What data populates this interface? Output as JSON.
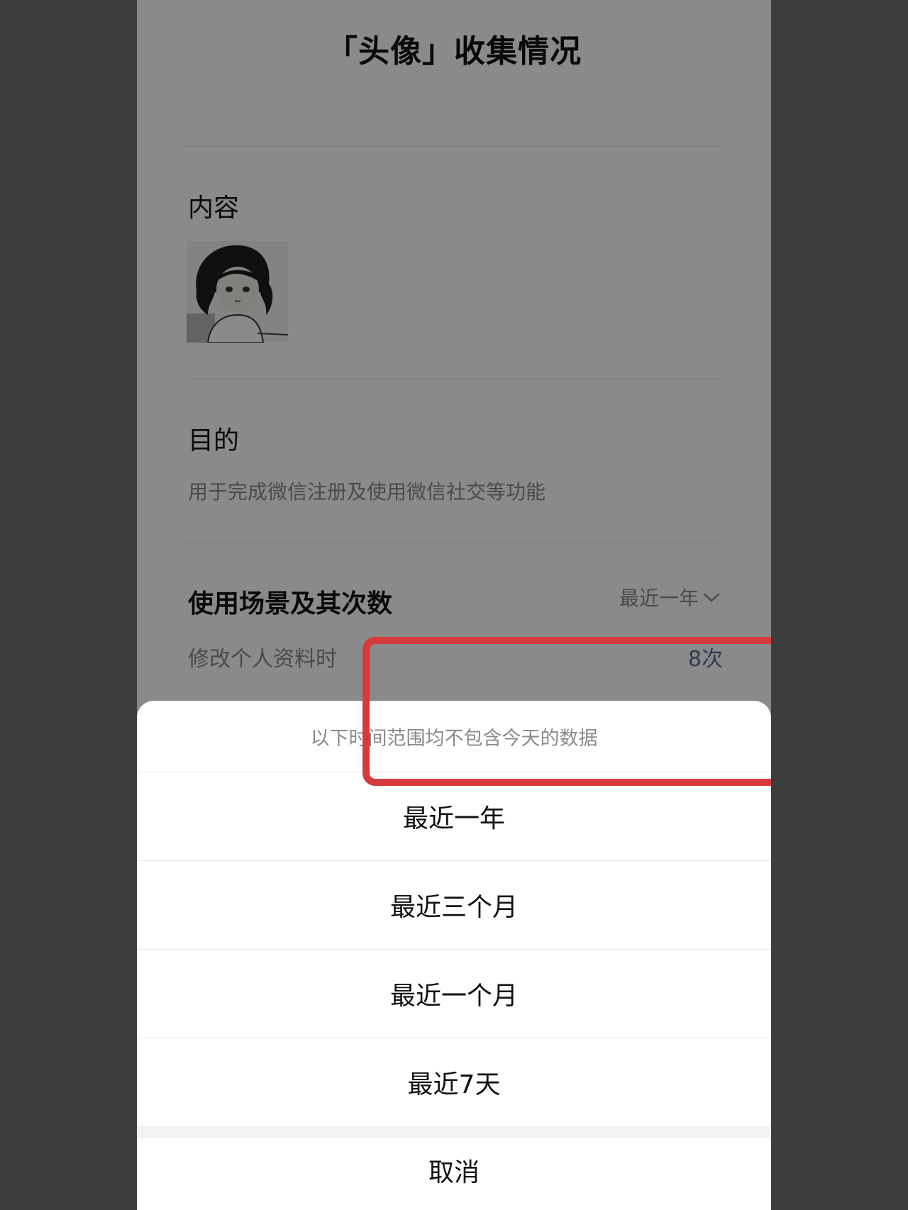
{
  "page": {
    "title": "「头像」收集情况"
  },
  "content_section": {
    "label": "内容"
  },
  "purpose_section": {
    "label": "目的",
    "text": "用于完成微信注册及使用微信社交等功能"
  },
  "usage_section": {
    "label": "使用场景及其次数",
    "range_label": "最近一年",
    "rows": [
      {
        "scene": "修改个人资料时",
        "count": "8次"
      }
    ]
  },
  "action_sheet": {
    "hint": "以下时间范围均不包含今天的数据",
    "options": [
      "最近一年",
      "最近三个月",
      "最近一个月",
      "最近7天"
    ],
    "cancel": "取消"
  },
  "colors": {
    "backdrop": "#3d3d3d",
    "count_link": "#576b95",
    "annotation_red": "#d63a3a"
  },
  "icons": {
    "range_chevron": "chevron-down-icon"
  }
}
